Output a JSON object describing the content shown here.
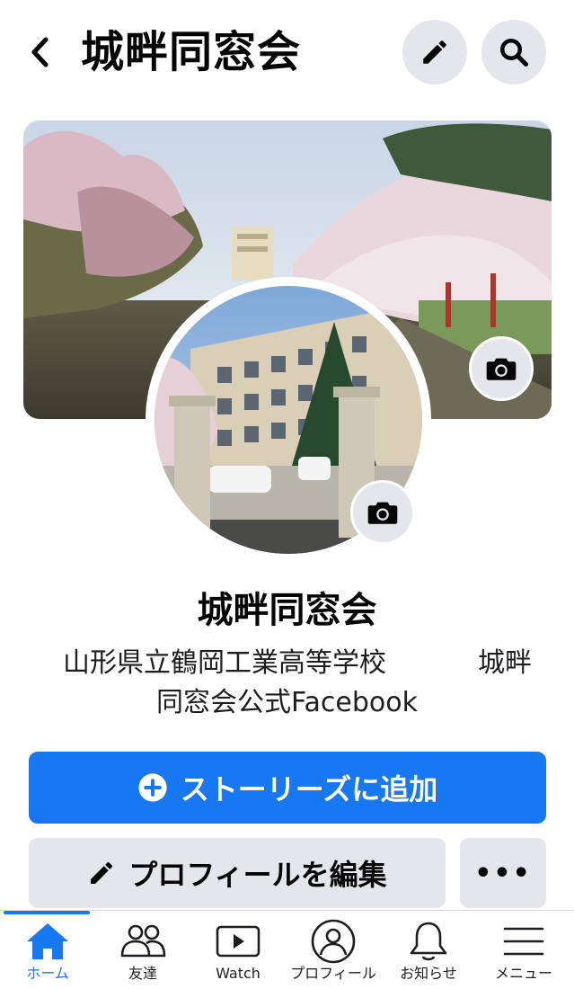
{
  "header": {
    "title": "城畔同窓会",
    "back_icon": "chevron-left-icon",
    "edit_icon": "pencil-icon",
    "search_icon": "search-icon"
  },
  "cover": {
    "camera_icon": "camera-icon"
  },
  "avatar": {
    "camera_icon": "camera-icon"
  },
  "profile": {
    "name": "城畔同窓会",
    "bio_line1_left": "山形県立鶴岡工業高等学校",
    "bio_line1_right": "城畔",
    "bio_line2": "同窓会公式Facebook"
  },
  "actions": {
    "primary_label": "ストーリーズに追加",
    "primary_icon": "plus-circle-icon",
    "edit_profile_label": "プロフィールを編集",
    "edit_profile_icon": "pencil-icon",
    "more_label": "•••"
  },
  "bottom_nav": {
    "items": [
      {
        "label": "ホーム",
        "icon": "home-icon",
        "active": true
      },
      {
        "label": "友達",
        "icon": "friends-icon",
        "active": false
      },
      {
        "label": "Watch",
        "icon": "watch-icon",
        "active": false
      },
      {
        "label": "プロフィール",
        "icon": "profile-icon",
        "active": false
      },
      {
        "label": "お知らせ",
        "icon": "bell-icon",
        "active": false
      },
      {
        "label": "メニュー",
        "icon": "menu-icon",
        "active": false
      }
    ]
  },
  "colors": {
    "accent": "#1877f2",
    "button_gray": "#e4e6eb",
    "text": "#050505"
  }
}
